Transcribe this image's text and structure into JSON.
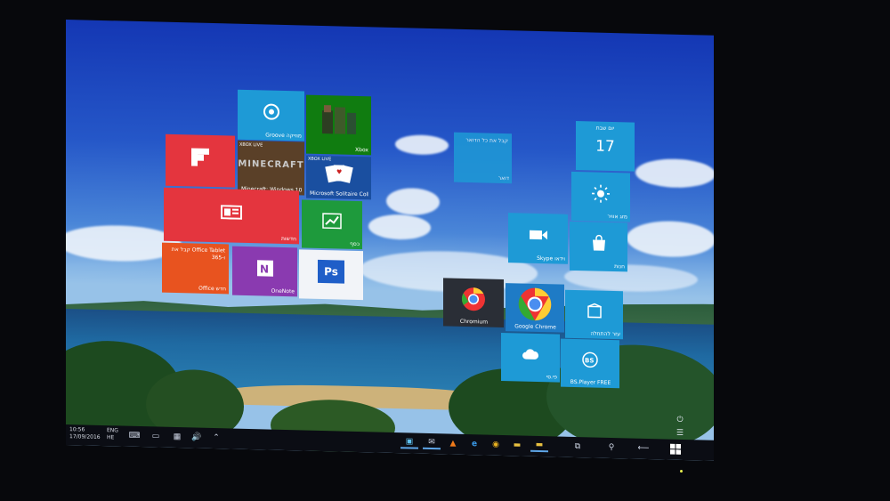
{
  "taskbar": {
    "time": "10:56",
    "date": "17/09/2016",
    "language": "ENG",
    "language_sub": "HE"
  },
  "tiles": {
    "groove": "Groove מוזיקה",
    "xbox": "Xbox",
    "xbox_live_1": "XBOX LIVE",
    "xbox_live_2": "XBOX LIVE",
    "minecraft": "Minecraft: Windows 10",
    "minecraft_logo": "MINECRAFT",
    "solitaire": "Microsoft Solitaire Collection",
    "flipboard": "",
    "news": "חדשות",
    "money": "כסף",
    "office_label": "Office חדש",
    "office_promo": "קבל את Office Tablet ו-365",
    "onenote": "OneNote",
    "photoshop": "",
    "photoshop_glyph": "Ps",
    "mail": "דואר",
    "mail_promo": "קבל את כל הדואר",
    "calendar_day": "17",
    "calendar_name": "יום שבת",
    "weather": "מזג אוויר",
    "skype": "Skype וידאו",
    "store": "חנות",
    "chromium": "Chromium",
    "chrome": "Google Chrome",
    "tile_a": "עזר להתחלה",
    "tile_b": "פי.סי",
    "bsplayer": "BS.Player FREE"
  },
  "colors": {
    "accent_blue": "#1e9ad6",
    "tile_red": "#e4353e",
    "tile_orange": "#e8531f",
    "tile_purple": "#8a3ab0",
    "tile_green": "#1e9a3c",
    "taskbar": "#0b0d14"
  },
  "icons": {
    "groove": "groove-disc-icon",
    "weather": "sun-icon",
    "store": "store-bag-icon",
    "skype": "video-camera-icon"
  }
}
